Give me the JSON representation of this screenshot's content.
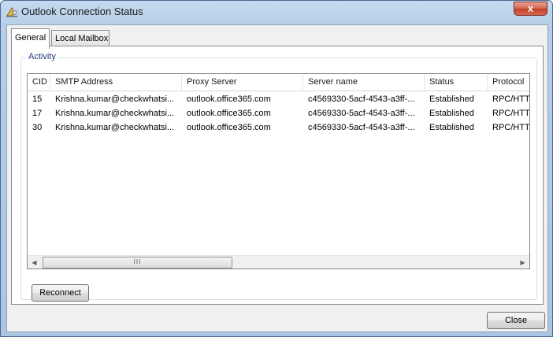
{
  "window": {
    "title": "Outlook Connection Status",
    "close_glyph": "x"
  },
  "tabs": [
    {
      "label": "General"
    },
    {
      "label": "Local Mailbox"
    }
  ],
  "activity": {
    "group_label": "Activity",
    "columns": [
      "CID",
      "SMTP Address",
      "Proxy Server",
      "Server name",
      "Status",
      "Protocol"
    ],
    "rows": [
      [
        "15",
        "Krishna.kumar@checkwhatsi...",
        "outlook.office365.com",
        "c4569330-5acf-4543-a3ff-...",
        "Established",
        "RPC/HTTP"
      ],
      [
        "17",
        "Krishna.kumar@checkwhatsi...",
        "outlook.office365.com",
        "c4569330-5acf-4543-a3ff-...",
        "Established",
        "RPC/HTTP"
      ],
      [
        "30",
        "Krishna.kumar@checkwhatsi...",
        "outlook.office365.com",
        "c4569330-5acf-4543-a3ff-...",
        "Established",
        "RPC/HTTP"
      ]
    ],
    "scroll_thumb_grip": "III"
  },
  "buttons": {
    "reconnect": "Reconnect",
    "close": "Close"
  }
}
